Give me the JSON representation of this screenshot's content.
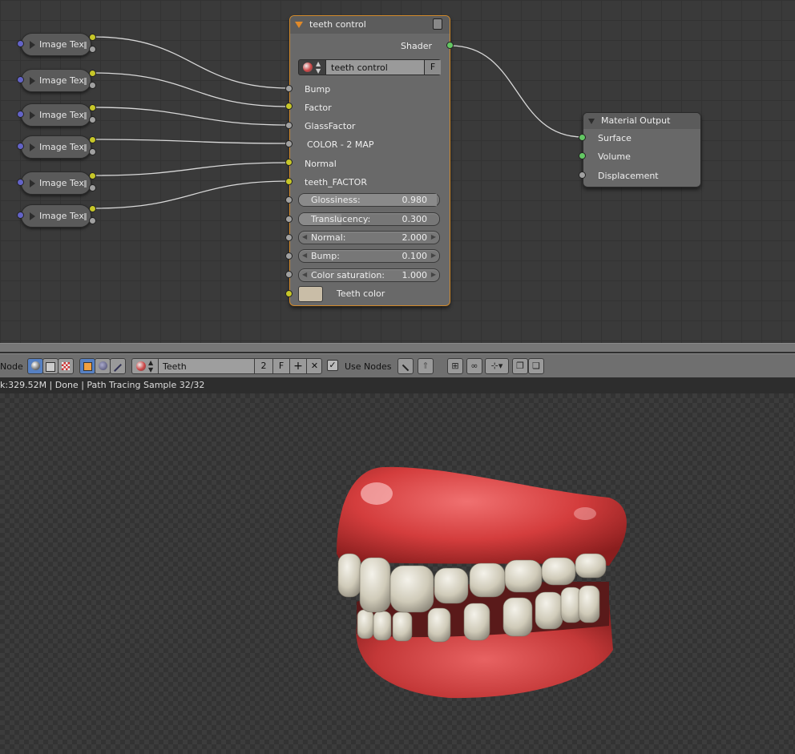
{
  "colors": {
    "group_border": "#d28a2b",
    "socket_yellow": "#c7c729",
    "socket_grey": "#a1a1a1",
    "socket_green": "#63c763",
    "socket_blue": "#6363c7",
    "active_button": "#5680c2"
  },
  "image_nodes": [
    {
      "label": "Image Tex"
    },
    {
      "label": "Image Tex"
    },
    {
      "label": "Image Tex"
    },
    {
      "label": "Image Tex"
    },
    {
      "label": "Image Tex"
    },
    {
      "label": "Image Tex"
    }
  ],
  "group_node": {
    "title": "teeth control",
    "output_label": "Shader",
    "datablock_name": "teeth control",
    "fake_user": "F",
    "inputs": [
      "Bump",
      "Factor",
      "GlassFactor",
      "COLOR - 2 MAP",
      "Normal",
      "teeth_FACTOR"
    ],
    "fields": [
      {
        "label": "Glossiness:",
        "value": "0.980",
        "fill": 0.98
      },
      {
        "label": "Translucency:",
        "value": "0.300",
        "fill": 0.3
      },
      {
        "label": "Normal:",
        "value": "2.000"
      },
      {
        "label": "Bump:",
        "value": "0.100"
      },
      {
        "label": "Color saturation:",
        "value": "1.000"
      }
    ],
    "color_input_label": "Teeth color"
  },
  "output_node": {
    "title": "Material Output",
    "inputs": [
      "Surface",
      "Volume",
      "Displacement"
    ]
  },
  "header": {
    "editor_label": "Node",
    "material_name": "Teeth",
    "users": "2",
    "fake_user": "F",
    "use_nodes_label": "Use Nodes",
    "use_nodes_checked": true
  },
  "status": {
    "text": "k:329.52M | Done | Path Tracing Sample 32/32"
  }
}
